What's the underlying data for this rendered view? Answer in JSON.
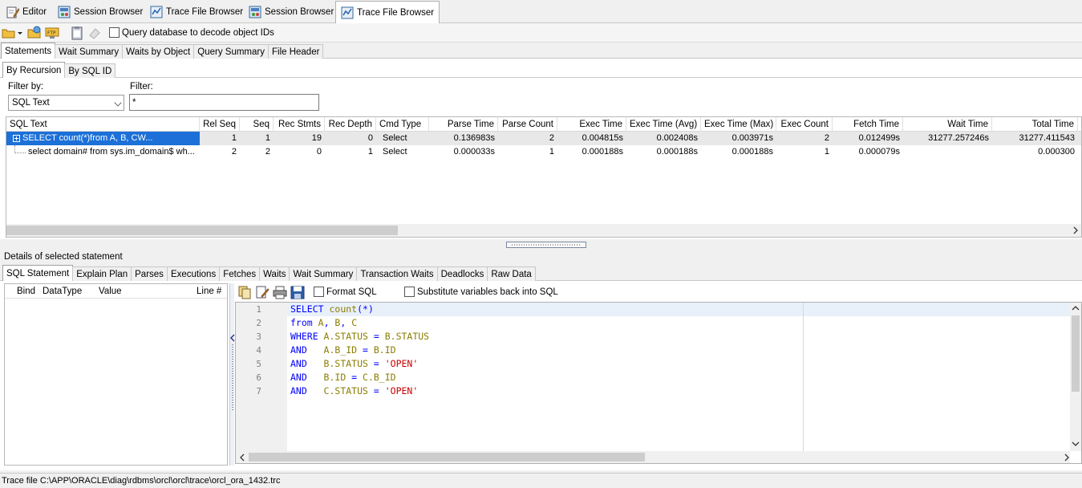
{
  "doc_tabs": [
    {
      "label": "Editor",
      "icon": "pencil-icon"
    },
    {
      "label": "Session Browser",
      "icon": "session-browser-icon"
    },
    {
      "label": "Trace File Browser",
      "icon": "trace-file-icon"
    },
    {
      "label": "Session Browser",
      "icon": "session-browser-icon"
    },
    {
      "label": "Trace File Browser",
      "icon": "trace-file-icon",
      "active": true
    }
  ],
  "toolbar": {
    "query_db_label": "Query database to decode object IDs"
  },
  "main_tabs": [
    "Statements",
    "Wait Summary",
    "Waits by Object",
    "Query Summary",
    "File Header"
  ],
  "sub_tabs": [
    "By Recursion",
    "By SQL ID"
  ],
  "filter": {
    "filter_by_label": "Filter by:",
    "filter_by_value": "SQL Text",
    "filter_label": "Filter:",
    "filter_value": "*"
  },
  "grid": {
    "columns": [
      "SQL Text",
      "Rel Seq",
      "Seq",
      "Rec Stmts",
      "Rec Depth",
      "Cmd Type",
      "Parse Time",
      "Parse Count",
      "Exec Time",
      "Exec Time (Avg)",
      "Exec Time (Max)",
      "Exec Count",
      "Fetch Time",
      "Wait Time",
      "Total Time"
    ],
    "rows": [
      {
        "sql": "SELECT count(*)from A, B, CW...",
        "rel_seq": "1",
        "seq": "1",
        "rec_stmts": "19",
        "rec_depth": "0",
        "cmd": "Select",
        "parse_time": "0.136983s",
        "parse_count": "2",
        "exec_time": "0.004815s",
        "exec_avg": "0.002408s",
        "exec_max": "0.003971s",
        "exec_count": "2",
        "fetch_time": "0.012499s",
        "wait_time": "31277.257246s",
        "total_time": "31277.411543"
      },
      {
        "sql": "select domain# from sys.im_domain$ wh...",
        "rel_seq": "2",
        "seq": "2",
        "rec_stmts": "0",
        "rec_depth": "1",
        "cmd": "Select",
        "parse_time": "0.000033s",
        "parse_count": "1",
        "exec_time": "0.000188s",
        "exec_avg": "0.000188s",
        "exec_max": "0.000188s",
        "exec_count": "1",
        "fetch_time": "0.000079s",
        "wait_time": "",
        "total_time": "0.000300"
      }
    ]
  },
  "details_label": "Details of selected statement",
  "detail_tabs": [
    "SQL Statement",
    "Explain Plan",
    "Parses",
    "Executions",
    "Fetches",
    "Waits",
    "Wait Summary",
    "Transaction Waits",
    "Deadlocks",
    "Raw Data"
  ],
  "bind_columns": [
    "Bind",
    "DataType",
    "Value",
    "Line #"
  ],
  "sql_toolbar": {
    "format_sql_label": "Format SQL",
    "substitute_label": "Substitute variables back into SQL"
  },
  "code_lines": [
    {
      "n": "1",
      "tokens": [
        {
          "t": "kw",
          "v": "SELECT "
        },
        {
          "t": "id",
          "v": "count"
        },
        {
          "t": "kw",
          "v": "(*)"
        }
      ]
    },
    {
      "n": "2",
      "tokens": [
        {
          "t": "kw",
          "v": "from "
        },
        {
          "t": "id",
          "v": "A"
        },
        {
          "t": "kw",
          "v": ", "
        },
        {
          "t": "id",
          "v": "B"
        },
        {
          "t": "kw",
          "v": ", "
        },
        {
          "t": "id",
          "v": "C"
        }
      ]
    },
    {
      "n": "3",
      "tokens": [
        {
          "t": "kw",
          "v": "WHERE "
        },
        {
          "t": "id",
          "v": "A.STATUS"
        },
        {
          "t": "kw",
          "v": " = "
        },
        {
          "t": "id",
          "v": "B.STATUS"
        }
      ]
    },
    {
      "n": "4",
      "tokens": [
        {
          "t": "kw",
          "v": "AND   "
        },
        {
          "t": "id",
          "v": "A.B_ID"
        },
        {
          "t": "kw",
          "v": " = "
        },
        {
          "t": "id",
          "v": "B.ID"
        }
      ]
    },
    {
      "n": "5",
      "tokens": [
        {
          "t": "kw",
          "v": "AND   "
        },
        {
          "t": "id",
          "v": "B.STATUS"
        },
        {
          "t": "kw",
          "v": " = "
        },
        {
          "t": "str",
          "v": "'OPEN'"
        }
      ]
    },
    {
      "n": "6",
      "tokens": [
        {
          "t": "kw",
          "v": "AND   "
        },
        {
          "t": "id",
          "v": "B.ID"
        },
        {
          "t": "kw",
          "v": " = "
        },
        {
          "t": "id",
          "v": "C.B_ID"
        }
      ]
    },
    {
      "n": "7",
      "tokens": [
        {
          "t": "kw",
          "v": "AND   "
        },
        {
          "t": "id",
          "v": "C.STATUS"
        },
        {
          "t": "kw",
          "v": " = "
        },
        {
          "t": "str",
          "v": "'OPEN'"
        }
      ]
    }
  ],
  "status": "Trace file C:\\APP\\ORACLE\\diag\\rdbms\\orcl\\orcl\\trace\\orcl_ora_1432.trc"
}
